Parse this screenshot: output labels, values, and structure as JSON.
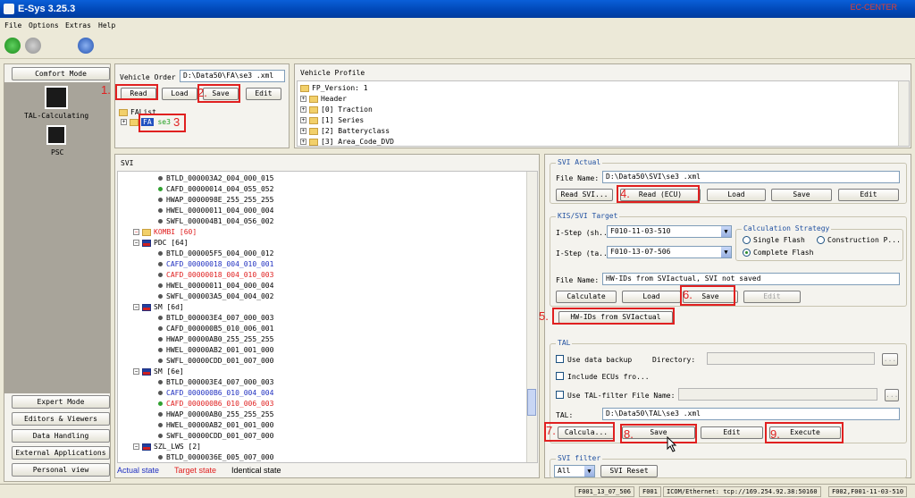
{
  "window": {
    "title": "E-Sys 3.25.3",
    "watermark": "EC-CENTER"
  },
  "menu": [
    "File",
    "Options",
    "Extras",
    "Help"
  ],
  "colors": {
    "actual": "#2030c0",
    "target": "#e02020",
    "identical": "#000000",
    "annot": "#e02020"
  },
  "left_nav": {
    "top": "Comfort Mode",
    "items": [
      {
        "label": "TAL-Calculating",
        "icon": "tal-calculating-icon"
      },
      {
        "label": "PSC",
        "icon": "psc-icon"
      }
    ],
    "bottom": [
      "Expert Mode",
      "Editors & Viewers",
      "Data Handling",
      "External Applications",
      "Personal view"
    ]
  },
  "vehicle_order": {
    "label": "Vehicle Order",
    "value": "D:\\Data50\\FA\\se3    .xml",
    "buttons": [
      "Read",
      "Load",
      "Save",
      "Edit"
    ],
    "tree_root": "FAList",
    "tree_item": "FA",
    "tree_item_suffix": "se3"
  },
  "vehicle_profile": {
    "title": "Vehicle Profile",
    "root": "FP_Version: 1",
    "items": [
      "Header",
      "[0] Traction",
      "[1] Series",
      "[2] Batteryclass",
      "[3] Area_Code_DVD"
    ]
  },
  "svi": {
    "title": "SVI",
    "nodes": [
      {
        "t": "BTLD_000003A2_004_000_015",
        "c": "black",
        "i": 2
      },
      {
        "t": "CAFD_00000014_004_055_052",
        "c": "black",
        "i": 2,
        "d": "green"
      },
      {
        "t": "HWAP_0000098E_255_255_255",
        "c": "black",
        "i": 2
      },
      {
        "t": "HWEL_00000011_004_000_004",
        "c": "black",
        "i": 2
      },
      {
        "t": "SWFL_000004B1_004_056_002",
        "c": "black",
        "i": 2
      },
      {
        "t": "KOMBI [60]",
        "c": "red",
        "i": 1,
        "f": "folder"
      },
      {
        "t": "PDC [64]",
        "c": "black",
        "i": 1,
        "f": "flag"
      },
      {
        "t": "BTLD_000005F5_004_000_012",
        "c": "black",
        "i": 2
      },
      {
        "t": "CAFD_00000018_004_010_001",
        "c": "blue",
        "i": 2
      },
      {
        "t": "CAFD_00000018_004_010_003",
        "c": "red",
        "i": 2
      },
      {
        "t": "HWEL_00000011_004_000_004",
        "c": "black",
        "i": 2
      },
      {
        "t": "SWFL_000003A5_004_004_002",
        "c": "black",
        "i": 2
      },
      {
        "t": "SM [6d]",
        "c": "black",
        "i": 1,
        "f": "flag"
      },
      {
        "t": "BTLD_000003E4_007_000_003",
        "c": "black",
        "i": 2
      },
      {
        "t": "CAFD_000000B5_010_006_001",
        "c": "black",
        "i": 2
      },
      {
        "t": "HWAP_00000AB0_255_255_255",
        "c": "black",
        "i": 2
      },
      {
        "t": "HWEL_00000AB2_001_001_000",
        "c": "black",
        "i": 2
      },
      {
        "t": "SWFL_00000CDD_001_007_000",
        "c": "black",
        "i": 2
      },
      {
        "t": "SM [6e]",
        "c": "black",
        "i": 1,
        "f": "flag"
      },
      {
        "t": "BTLD_000003E4_007_000_003",
        "c": "black",
        "i": 2
      },
      {
        "t": "CAFD_000000B6_010_004_004",
        "c": "blue",
        "i": 2
      },
      {
        "t": "CAFD_000000B6_010_006_003",
        "c": "red",
        "i": 2,
        "d": "green"
      },
      {
        "t": "HWAP_00000AB0_255_255_255",
        "c": "black",
        "i": 2
      },
      {
        "t": "HWEL_00000AB2_001_001_000",
        "c": "black",
        "i": 2
      },
      {
        "t": "SWFL_00000CDD_001_007_000",
        "c": "black",
        "i": 2
      },
      {
        "t": "SZL_LWS [2]",
        "c": "black",
        "i": 1,
        "f": "flag"
      },
      {
        "t": "BTLD_0000036E_005_007_000",
        "c": "black",
        "i": 2
      }
    ],
    "legend": [
      "Actual state",
      "Target state",
      "Identical state"
    ]
  },
  "svi_actual": {
    "title": "SVI Actual",
    "file_label": "File Name:",
    "file_value": "D:\\Data50\\SVI\\se3    .xml",
    "buttons": [
      "Read SVI...",
      "Read (ECU)",
      "Load",
      "Save",
      "Edit"
    ]
  },
  "kis": {
    "title": "KIS/SVI Target",
    "istep_sh_label": "I-Step (sh...",
    "istep_sh": "F010-11-03-510",
    "istep_ta_label": "I-Step (ta...",
    "istep_ta": "F010-13-07-506",
    "strategy_title": "Calculation Strategy",
    "opt_single": "Single Flash",
    "opt_construction": "Construction P...",
    "opt_complete": "Complete Flash",
    "file_label": "File Name:",
    "file_value": "HW-IDs from SVIactual, SVI not saved",
    "buttons": [
      "Calculate",
      "Load",
      "Save",
      "Edit"
    ],
    "hwids": "HW-IDs from SVIactual"
  },
  "tal": {
    "title": "TAL",
    "backup": "Use data backup",
    "directory": "Directory:",
    "include": "Include ECUs fro...",
    "filter": "Use TAL-filter File Name:",
    "tal_label": "TAL:",
    "tal_value": "D:\\Data50\\TAL\\se3    .xml",
    "buttons": [
      "Calcula...",
      "Save",
      "Edit",
      "Execute"
    ]
  },
  "svi_filter": {
    "title": "SVI filter",
    "value": "All",
    "reset": "SVI Reset"
  },
  "annotations": [
    "1.",
    "2.",
    "3",
    "4.",
    "5.",
    "6.",
    "7.",
    "8.",
    "9."
  ],
  "statusbar": [
    "F001_13_07_506",
    "F001",
    "ICOM/Ethernet: tcp://169.254.92.38:50160",
    "F002,F001-11-03-510"
  ]
}
